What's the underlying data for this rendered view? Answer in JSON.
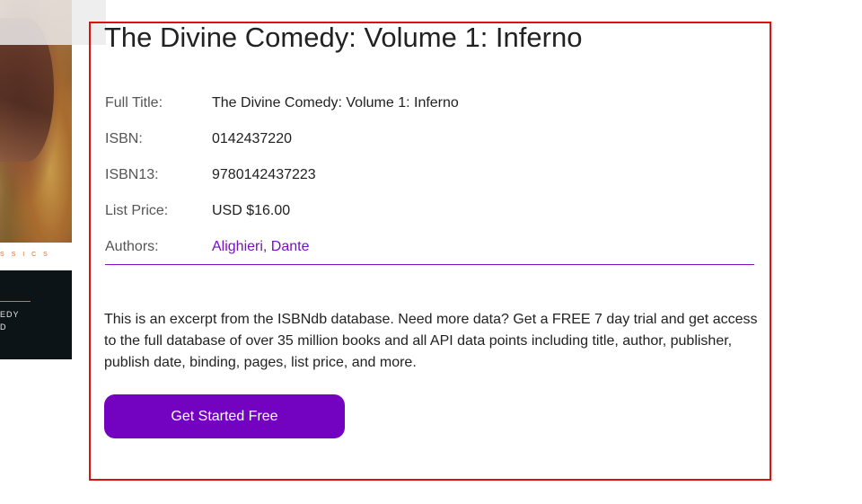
{
  "book": {
    "title": "The Divine Comedy: Volume 1: Inferno"
  },
  "cover": {
    "series_text": "S S I C S",
    "line1": "EDY",
    "line2": "D"
  },
  "details": [
    {
      "label": "Full Title:",
      "value": "The Divine Comedy: Volume 1: Inferno"
    },
    {
      "label": "ISBN:",
      "value": "0142437220"
    },
    {
      "label": "ISBN13:",
      "value": "9780142437223"
    },
    {
      "label": "List Price:",
      "value": "USD $16.00"
    },
    {
      "label": "Authors:",
      "value": "Alighieri, Dante"
    }
  ],
  "excerpt": "This is an excerpt from the ISBNdb database. Need more data? Get a FREE 7 day trial and get access to the full database of over 35 million books and all API data points including title, author, publisher, publish date, binding, pages, list price, and more.",
  "cta": {
    "label": "Get Started Free"
  },
  "colors": {
    "accent": "#7403c1",
    "link": "#7a0fc0",
    "highlight_frame": "#e01010"
  }
}
